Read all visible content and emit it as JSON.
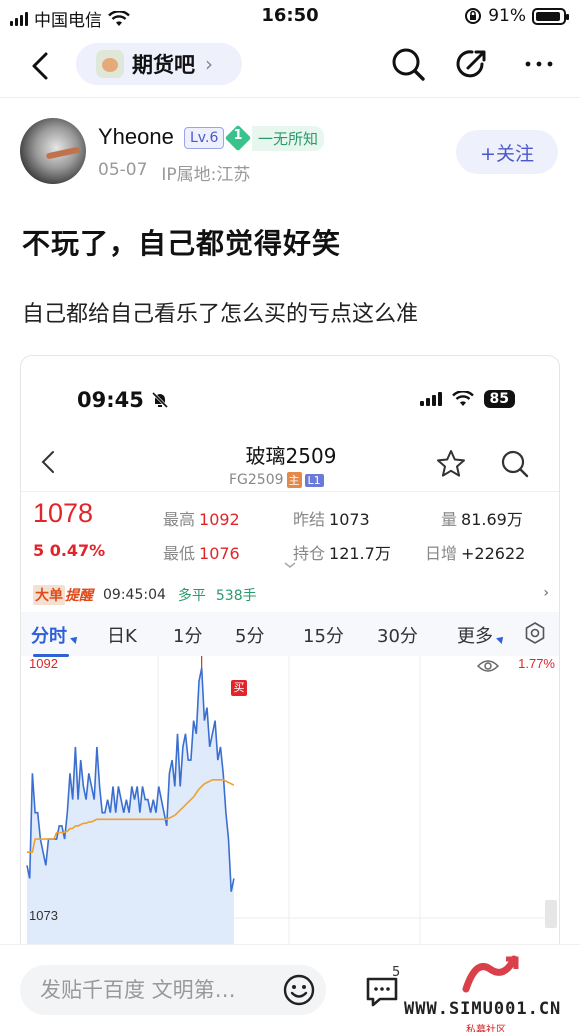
{
  "status_bar": {
    "carrier": "中国电信",
    "time": "16:50",
    "battery": "91%",
    "battery_level": 0.91
  },
  "nav": {
    "forum_name": "期货吧",
    "chevron": "›"
  },
  "post": {
    "author": "Yheone",
    "level": "Lv.6",
    "fan_level": "1",
    "fan_label": "一无所知",
    "date": "05-07",
    "ip": "IP属地:江苏",
    "follow_label": "+关注",
    "title": "不玩了，自己都觉得好笑",
    "body": "自己都给自己看乐了怎么买的亏点这么准"
  },
  "embedded": {
    "status": {
      "time": "09:45",
      "battery": "85"
    },
    "instrument": {
      "name": "玻璃2509",
      "code": "FG2509",
      "tag_main": "主",
      "tag_l1": "L1"
    },
    "quote": {
      "price": "1078",
      "change": "5  0.47%",
      "high_label": "最高",
      "high": "1092",
      "low_label": "最低",
      "low": "1076",
      "prev_label": "昨结",
      "prev": "1073",
      "oi_label": "持仓",
      "oi": "121.7万",
      "vol_label": "量",
      "vol": "81.69万",
      "daily_label": "日增",
      "daily": "+22622"
    },
    "alert": {
      "tag": "大单",
      "tag2": "提醒",
      "time": "09:45:04",
      "type": "多平",
      "volume": "538手",
      "arrow": "›"
    },
    "periods": [
      "分时",
      "日K",
      "1分",
      "5分",
      "15分",
      "30分",
      "更多"
    ],
    "chart_axis": {
      "top_price": "1092",
      "bottom_price": "1073",
      "top_pct": "1.77%",
      "buy_marker": "买"
    }
  },
  "bottom": {
    "comment_placeholder": "发贴千百度 文明第…",
    "comment_count": "5",
    "watermark": "WWW.SIMU001.CN",
    "watermark_sub": "私募社区"
  },
  "chart_data": {
    "type": "line",
    "series": [
      {
        "values": [
          1077,
          1076,
          1084,
          1081,
          1081,
          1079,
          1078,
          1077,
          1079,
          1079,
          1079,
          1079,
          1080,
          1080,
          1079,
          1081,
          1084,
          1082,
          1086,
          1082,
          1085,
          1083,
          1082,
          1084,
          1083,
          1082,
          1086,
          1083,
          1081,
          1081,
          1082,
          1081,
          1083,
          1081,
          1083,
          1082,
          1081,
          1082,
          1081,
          1083,
          1082,
          1083,
          1081,
          1083,
          1082,
          1082,
          1081,
          1082,
          1081,
          1083,
          1082,
          1081,
          1080,
          1084,
          1085,
          1083,
          1087,
          1083,
          1086,
          1087,
          1085,
          1085,
          1088,
          1087,
          1091,
          1092,
          1088,
          1089,
          1086,
          1087,
          1088,
          1085,
          1086,
          1084,
          1081,
          1079,
          1075,
          1076
        ]
      },
      {
        "values": [
          1078,
          1078,
          1078,
          1079,
          1079,
          1079,
          1079,
          1079,
          1079,
          1079,
          1079,
          1079.5,
          1079.5,
          1079.5,
          1079.5,
          1079.6,
          1079.8,
          1079.8,
          1080,
          1080,
          1080.1,
          1080.2,
          1080.2,
          1080.3,
          1080.3,
          1080.4,
          1080.5,
          1080.5,
          1080.5,
          1080.5,
          1080.5,
          1080.5,
          1080.5,
          1080.5,
          1080.5,
          1080.5,
          1080.5,
          1080.5,
          1080.5,
          1080.5,
          1080.5,
          1080.5,
          1080.5,
          1080.5,
          1080.5,
          1080.5,
          1080.5,
          1080.5,
          1080.5,
          1080.5,
          1080.5,
          1080.5,
          1080.5,
          1080.6,
          1080.7,
          1080.8,
          1081,
          1081.2,
          1081.4,
          1081.6,
          1081.8,
          1082,
          1082.2,
          1082.5,
          1082.8,
          1083,
          1083.2,
          1083.3,
          1083.4,
          1083.5,
          1083.5,
          1083.5,
          1083.5,
          1083.5,
          1083.4,
          1083.3,
          1083.2,
          1083.1
        ]
      }
    ],
    "ylim": [
      1073,
      1092
    ]
  }
}
